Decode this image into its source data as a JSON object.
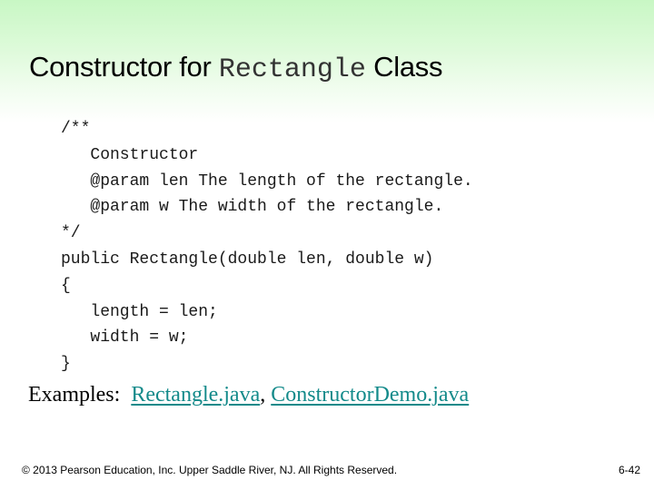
{
  "slide": {
    "title": {
      "prefix": "Constructor for ",
      "code_word": "Rectangle",
      "suffix": " Class"
    },
    "code_lines": [
      "/**",
      "   Constructor",
      "   @param len The length of the rectangle.",
      "   @param w The width of the rectangle.",
      "*/",
      "public Rectangle(double len, double w)",
      "{",
      "   length = len;",
      "   width = w;",
      "}"
    ],
    "examples": {
      "label": "Examples:  ",
      "links": [
        {
          "text": "Rectangle.java"
        },
        {
          "text": "ConstructorDemo.java"
        }
      ],
      "separator": ", "
    },
    "footer": {
      "copyright": "© 2013 Pearson Education, Inc. Upper Saddle River, NJ. All Rights Reserved.",
      "page_number": "6-42"
    },
    "colors": {
      "header_gradient_top": "#c8f7c4",
      "link": "#138a8a",
      "background": "#ffffff"
    }
  }
}
